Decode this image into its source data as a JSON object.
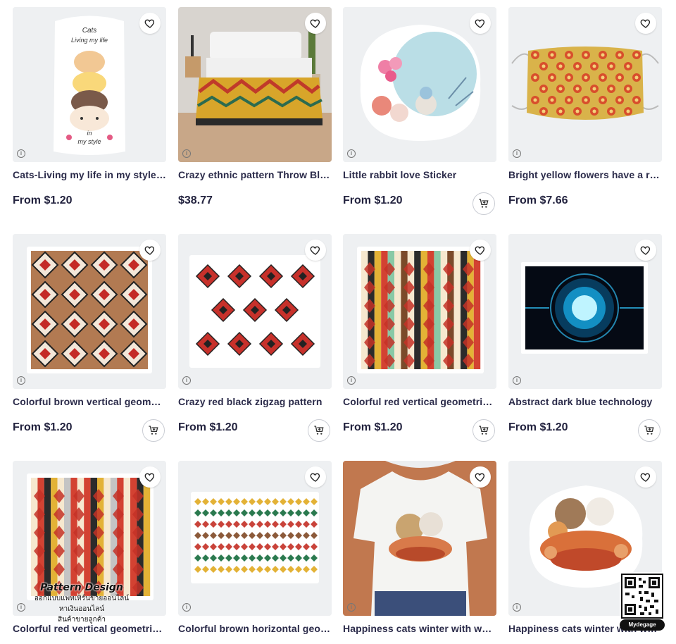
{
  "products": [
    {
      "title": "Cats-Living my life in my style Sticker",
      "price": "From $1.20",
      "cart": false,
      "art": "cats",
      "art_text": [
        "Cats",
        "Living my life",
        "in",
        "my style"
      ]
    },
    {
      "title": "Crazy ethnic pattern Throw Blanket",
      "price": "$38.77",
      "cart": false,
      "art": "bed"
    },
    {
      "title": "Little rabbit love Sticker",
      "price": "From $1.20",
      "cart": true,
      "art": "rabbit"
    },
    {
      "title": "Bright yellow flowers have a red center Mask",
      "price": "From $7.66",
      "cart": false,
      "art": "mask"
    },
    {
      "title": "Colorful brown vertical geometric pattern",
      "price": "From $1.20",
      "cart": true,
      "art": "brown"
    },
    {
      "title": "Crazy red black zigzag pattern",
      "price": "From $1.20",
      "cart": true,
      "art": "redzig"
    },
    {
      "title": "Colorful red vertical geometric pattern",
      "price": "From $1.20",
      "cart": true,
      "art": "stripes"
    },
    {
      "title": "Abstract dark blue technology",
      "price": "From $1.20",
      "cart": true,
      "art": "tech"
    },
    {
      "title": "Colorful red vertical geometric pattern",
      "price": "",
      "cart": false,
      "art": "stripes2"
    },
    {
      "title": "Colorful brown horizontal geometric pattern",
      "price": "",
      "cart": false,
      "art": "horiz"
    },
    {
      "title": "Happiness cats winter with warm clothes",
      "price": "",
      "cart": false,
      "art": "tshirt"
    },
    {
      "title": "Happiness cats winter with warm clothes",
      "price": "",
      "cart": false,
      "art": "catsticker"
    }
  ],
  "watermark": {
    "title": "Pattern Design",
    "line1": "ออกแบบแพทเทิร์นขายออนไลน์",
    "line2": "หาเงินออนไลน์",
    "line3": "สินค้าขายลูกค้า"
  },
  "qr_label": "Mydegage",
  "icons": {
    "favorite": "heart-icon",
    "info": "info-icon",
    "cart": "cart-icon"
  },
  "colors": {
    "text": "#2b2b4a",
    "thumb_bg": "#eef0f2",
    "price": "#23233f"
  }
}
